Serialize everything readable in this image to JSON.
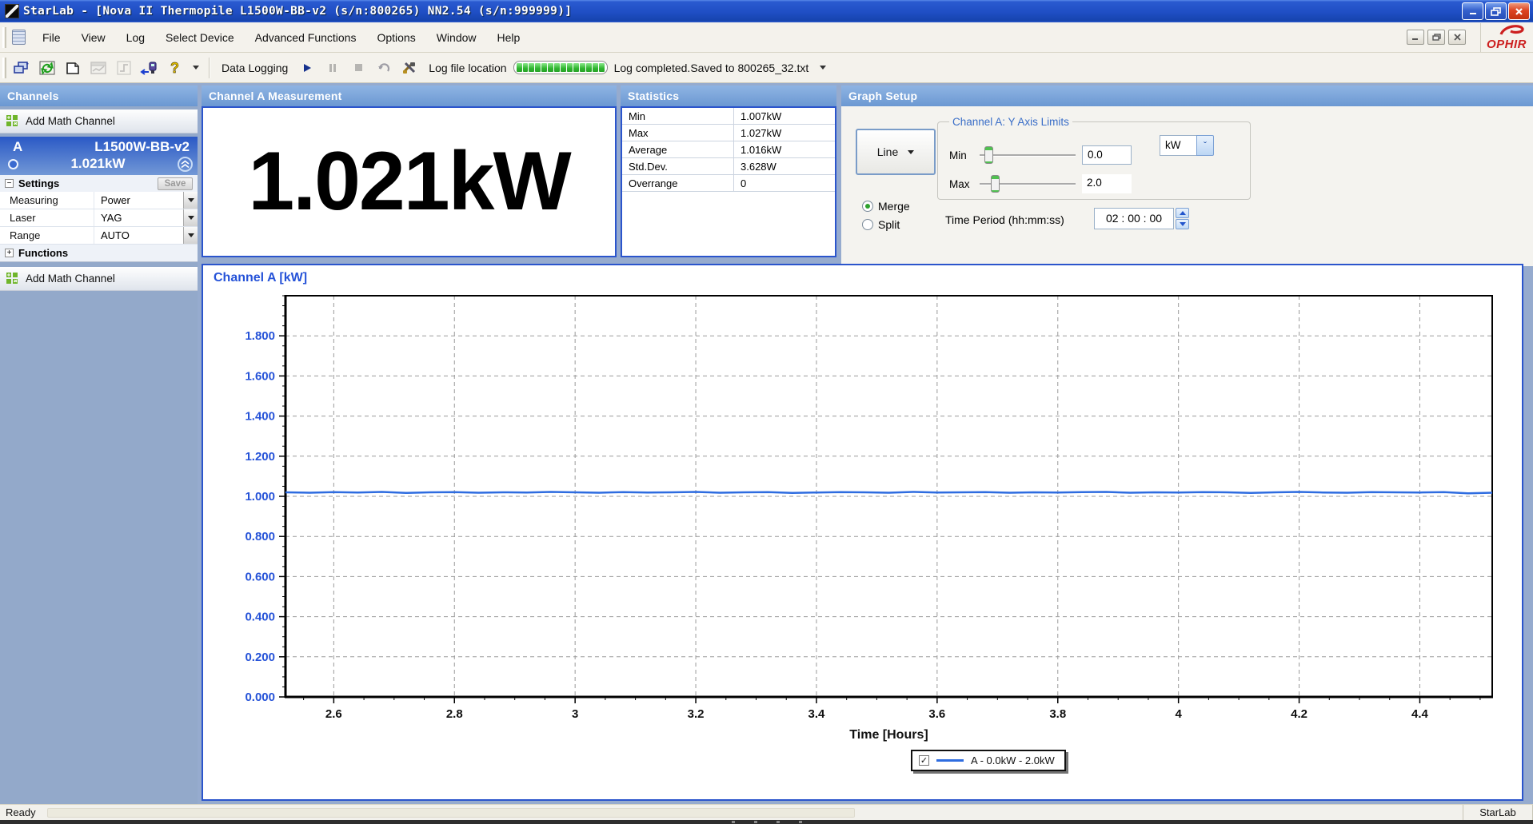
{
  "window": {
    "title": "StarLab - [Nova II Thermopile L1500W-BB-v2 (s/n:800265)  NN2.54 (s/n:999999)]"
  },
  "menu": {
    "items": [
      "File",
      "View",
      "Log",
      "Select Device",
      "Advanced Functions",
      "Options",
      "Window",
      "Help"
    ],
    "brand": "OPHIR"
  },
  "toolbar": {
    "data_logging_label": "Data Logging",
    "log_file_location_label": "Log file location",
    "log_status": "Log completed.Saved to 800265_32.txt",
    "progress_segments": 14,
    "icons": [
      "cascade-windows",
      "refresh",
      "new-document",
      "chart",
      "step-function",
      "connect-device",
      "help"
    ]
  },
  "glyphs": {
    "play": "▶",
    "pause": "❚❚",
    "stop": "■",
    "check": "✓",
    "help": "?"
  },
  "channels": {
    "header": "Channels",
    "add_math_channel": "Add Math Channel",
    "channel": {
      "id": "A",
      "device": "L1500W-BB-v2",
      "value": "1.021kW"
    },
    "settings": {
      "title": "Settings",
      "save_label": "Save",
      "rows": [
        {
          "label": "Measuring",
          "value": "Power"
        },
        {
          "label": "Laser",
          "value": "YAG"
        },
        {
          "label": "Range",
          "value": "AUTO"
        }
      ]
    },
    "functions_title": "Functions",
    "add_math_channel_2": "Add Math Channel"
  },
  "measurement": {
    "header": "Channel A Measurement",
    "value": "1.021kW"
  },
  "statistics": {
    "header": "Statistics",
    "rows": [
      [
        "Min",
        "1.007kW"
      ],
      [
        "Max",
        "1.027kW"
      ],
      [
        "Average",
        "1.016kW"
      ],
      [
        "Std.Dev.",
        "3.628W"
      ],
      [
        "Overrange",
        "0"
      ]
    ]
  },
  "graph_setup": {
    "header": "Graph Setup",
    "line_type": "Line",
    "y_axis": {
      "legend": "Channel A: Y Axis Limits",
      "min_label": "Min",
      "min_value": "0.0",
      "max_label": "Max",
      "max_value": "2.0",
      "unit": "kW"
    },
    "view_options": [
      {
        "label": "Merge",
        "selected": true
      },
      {
        "label": "Split",
        "selected": false
      }
    ],
    "time_period": {
      "label": "Time Period (hh:mm:ss)",
      "value": "02 : 00 : 00"
    }
  },
  "chart_data": {
    "type": "line",
    "title": "Channel A [kW]",
    "xlabel": "Time [Hours]",
    "ylabel": "",
    "xlim": [
      2.52,
      4.52
    ],
    "ylim": [
      0,
      2.0
    ],
    "xticks": [
      2.6,
      2.8,
      3,
      3.2,
      3.4,
      3.6,
      3.8,
      4,
      4.2,
      4.4
    ],
    "yticks": [
      "0.000",
      "0.200",
      "0.400",
      "0.600",
      "0.800",
      "1.000",
      "1.200",
      "1.400",
      "1.600",
      "1.800"
    ],
    "minor_tick_step": 0.05,
    "grid": true,
    "line_color": "#2e6ce0",
    "legend": {
      "label": "A - 0.0kW - 2.0kW",
      "checked": true,
      "position": "bottom-center"
    },
    "series": [
      {
        "name": "A",
        "x_uniform_over": [
          2.52,
          4.52
        ],
        "y": [
          1.02,
          1.018,
          1.021,
          1.019,
          1.022,
          1.017,
          1.02,
          1.021,
          1.018,
          1.02,
          1.019,
          1.022,
          1.02,
          1.018,
          1.021,
          1.019,
          1.02,
          1.022,
          1.018,
          1.02,
          1.021,
          1.017,
          1.019,
          1.021,
          1.02,
          1.018,
          1.022,
          1.019,
          1.02,
          1.021,
          1.018,
          1.02,
          1.019,
          1.021,
          1.022,
          1.018,
          1.02,
          1.019,
          1.021,
          1.02,
          1.017,
          1.02,
          1.022,
          1.019,
          1.018,
          1.021,
          1.02,
          1.019,
          1.021,
          1.015,
          1.018
        ]
      }
    ]
  },
  "status_bar": {
    "left": "Ready",
    "right": "StarLab"
  }
}
